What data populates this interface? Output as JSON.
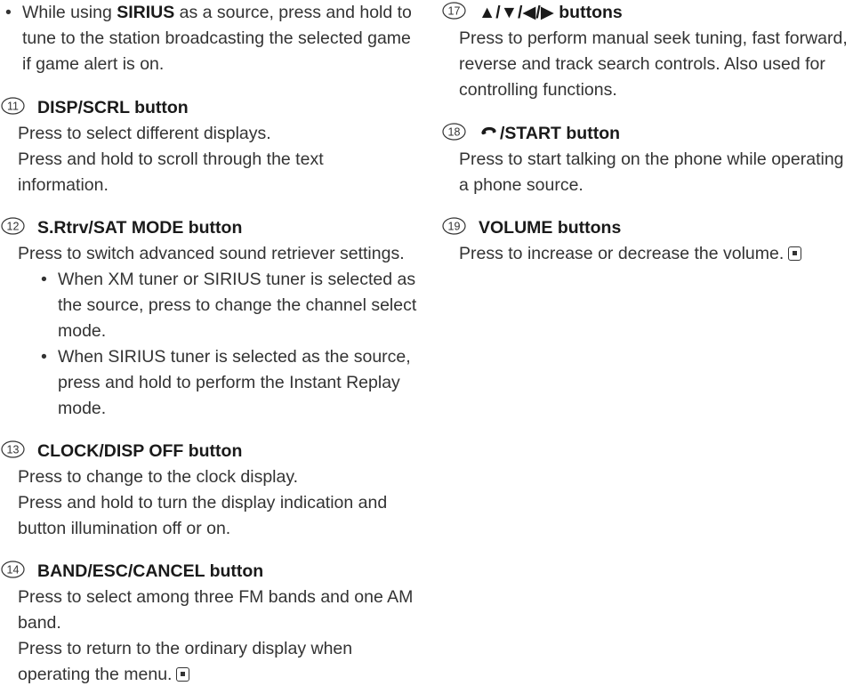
{
  "left": {
    "intro_bullet": {
      "before": "While using ",
      "bold": "SIRIUS",
      "after": " as a source, press and hold to tune to the station broadcasting the selected game if game alert is on."
    },
    "items": [
      {
        "number": "11",
        "title": "DISP/SCRL button",
        "paragraphs": [
          "Press to select different displays.",
          "Press and hold to scroll through the text information."
        ]
      },
      {
        "number": "12",
        "title": "S.Rtrv/SAT MODE button",
        "paragraphs": [
          "Press to switch advanced sound retriever settings."
        ],
        "bullets": [
          "When XM tuner or SIRIUS tuner is selected as the source, press to change the channel select mode.",
          "When SIRIUS tuner is selected as the source, press and hold to perform the Instant Replay mode."
        ]
      },
      {
        "number": "13",
        "title": "CLOCK/DISP OFF button",
        "paragraphs": [
          "Press to change to the clock display.",
          "Press and hold to turn the display indication and button illumination off or on."
        ]
      },
      {
        "number": "14",
        "title": "BAND/ESC/CANCEL button",
        "paragraphs": [
          "Press to select among three FM bands and one AM band.",
          "Press to return to the ordinary display when operating the menu."
        ]
      }
    ]
  },
  "right": {
    "items": [
      {
        "number": "17",
        "title": "▲/▼/◀/▶ buttons",
        "paragraphs": [
          "Press to perform manual seek tuning, fast forward, reverse and track search controls. Also used for controlling functions."
        ]
      },
      {
        "number": "18",
        "title": "/START button",
        "paragraphs": [
          "Press to start talking on the phone while operating a phone source."
        ]
      },
      {
        "number": "19",
        "title": "VOLUME buttons",
        "paragraphs": [
          "Press to increase or decrease the volume."
        ]
      }
    ]
  },
  "icons": {
    "bullet": "•",
    "phone": "phone-icon",
    "end_of_section": "end-of-section-icon"
  }
}
